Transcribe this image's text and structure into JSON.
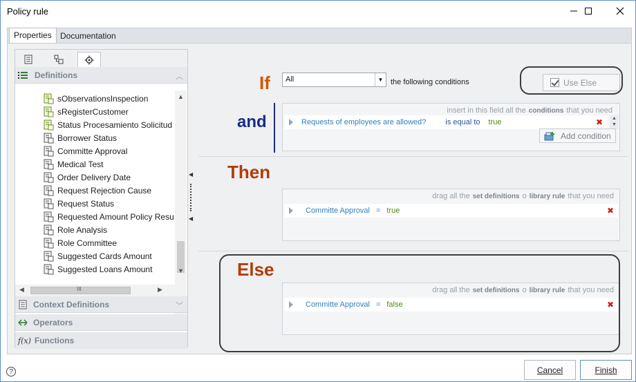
{
  "window": {
    "title": "Policy rule",
    "controls": {
      "minimize": "minimize",
      "maximize": "maximize",
      "close": "close"
    }
  },
  "top_tabs": [
    {
      "label": "Properties",
      "active": true
    },
    {
      "label": "Documentation",
      "active": false
    }
  ],
  "left_panel": {
    "icon_tabs": [
      "document-list-icon",
      "hierarchy-icon",
      "gear-icon"
    ],
    "sections": {
      "definitions": "Definitions",
      "context_definitions": "Context Definitions",
      "operators": "Operators",
      "functions": "Functions"
    },
    "tree_items": [
      "sObservationsInspection",
      "sRegisterCustomer",
      "Status Procesamiento Solicitud",
      "Borrower Status",
      "Committe Approval",
      "Medical Test",
      "Order Delivery Date",
      "Request Rejection Cause",
      "Request Status",
      "Requested Amount Policy Resu",
      "Role Analysis",
      "Role Committee",
      "Suggested Cards Amount",
      "Suggested Loans Amount"
    ],
    "hscroll_grip": "III"
  },
  "if_block": {
    "keyword": "If",
    "and_keyword": "and",
    "match_value": "All",
    "following_text": "the following conditions",
    "use_else_label": "Use Else",
    "use_else_checked": true,
    "hint": {
      "pre": "insert in this field all the",
      "bold": "conditions",
      "post": "that you need"
    },
    "condition": {
      "field": "Requests of employees are allowed?",
      "operator": "is equal to",
      "value": "true"
    },
    "add_condition_label": "Add condition"
  },
  "then_block": {
    "keyword": "Then",
    "hint": {
      "pre": "drag all the",
      "bold1": "set definitions",
      "mid": "o",
      "bold2": "library rule",
      "post": "that you need"
    },
    "row": {
      "field": "Committe Approval",
      "op": "=",
      "value": "true"
    }
  },
  "else_block": {
    "keyword": "Else",
    "hint": {
      "pre": "drag all the",
      "bold1": "set definitions",
      "mid": "o",
      "bold2": "library rule",
      "post": "that you need"
    },
    "row": {
      "field": "Committe Approval",
      "op": "=",
      "value": "false"
    }
  },
  "footer": {
    "cancel_label": "Cancel",
    "finish_label": "Finish",
    "help_label": "?"
  }
}
